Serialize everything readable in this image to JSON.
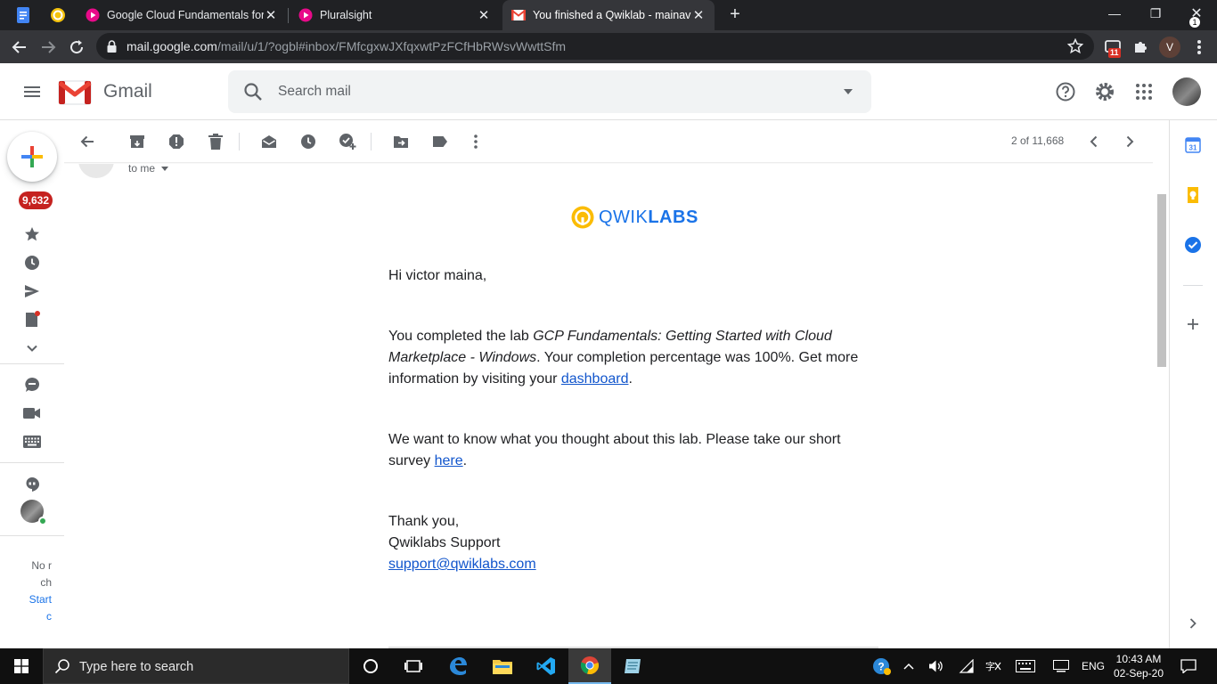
{
  "browser": {
    "tabs": [
      {
        "title": "Google Cloud Fundamentals for C",
        "active": false
      },
      {
        "title": "Pluralsight",
        "active": false
      },
      {
        "title": "You finished a Qwiklab - mainavic",
        "active": true
      }
    ],
    "new_tab": "+",
    "address": {
      "host": "mail.google.com",
      "path": "/mail/u/1/?ogbl#inbox/FMfcgxwJXfqxwtPzFCfHbRWsvWwttSfm"
    },
    "extension_badge": "11",
    "profile_initial": "V",
    "window": {
      "minimize": "—",
      "restore": "❐",
      "close": "✕"
    }
  },
  "gmail": {
    "app_name": "Gmail",
    "search": {
      "placeholder": "Search mail"
    },
    "unread_count": "9,632",
    "pager": "2 of 11,668",
    "hangouts_note": {
      "line1": "No r",
      "line2": "ch",
      "link1": "Start",
      "link2": "c"
    },
    "colors": {
      "accent": "#1a73e8",
      "badge": "#c5221f",
      "gmail_red": "#ea4335"
    }
  },
  "message": {
    "to_line": "to me",
    "logo": {
      "part1": "QWIK",
      "part2": "LABS"
    },
    "greeting": "Hi victor maina,",
    "p1_pre": "You completed the lab ",
    "p1_lab": "GCP Fundamentals: Getting Started with Cloud Marketplace - Windows",
    "p1_post": ". Your completion percentage was 100%. Get more information by visiting your ",
    "p1_link": "dashboard",
    "p1_end": ".",
    "p2_pre": "We want to know what you thought about this lab. Please take our short survey ",
    "p2_link": "here",
    "p2_end": ".",
    "closing": "Thank you,",
    "signature": "Qwiklabs Support",
    "email": "support@qwiklabs.com"
  },
  "taskbar": {
    "search_placeholder": "Type here to search",
    "language": "ENG",
    "time": "10:43 AM",
    "date": "02-Sep-20",
    "notification_count": "1"
  }
}
